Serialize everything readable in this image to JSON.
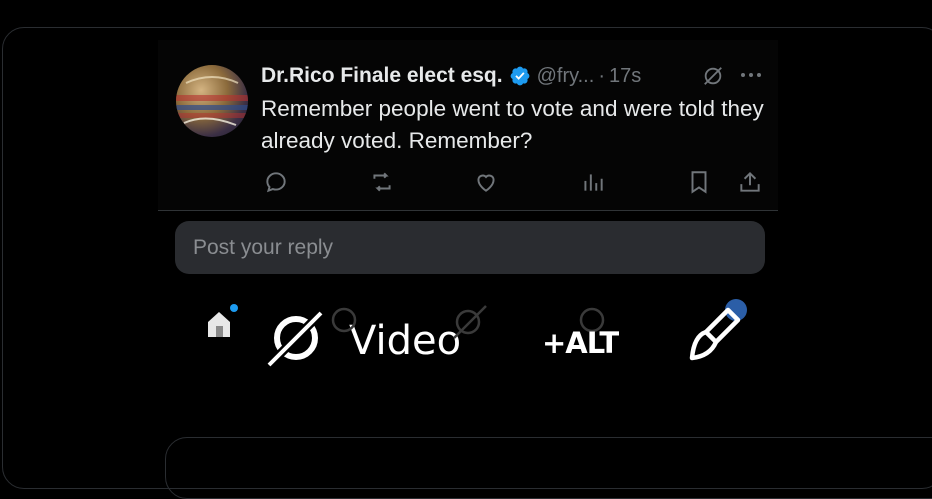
{
  "post": {
    "author_name": "Dr.Rico Finale elect esq.",
    "handle": "@fry...",
    "separator": "·",
    "time": "17s",
    "text": "Remember people went to vote and were told they already voted. Remember?",
    "actions": [
      "reply-icon",
      "repost-icon",
      "like-icon",
      "views-icon",
      "bookmark-icon",
      "share-icon"
    ]
  },
  "reply": {
    "placeholder": "Post your reply"
  },
  "overlay": {
    "video_label": "Video",
    "alt_label": "+ALT",
    "icons": [
      "home-icon",
      "grok-icon",
      "brush-icon"
    ]
  },
  "colors": {
    "background": "#000000",
    "verified": "#1d9bf0",
    "muted": "#71767b",
    "accent_dot": "#1d9bf0"
  }
}
